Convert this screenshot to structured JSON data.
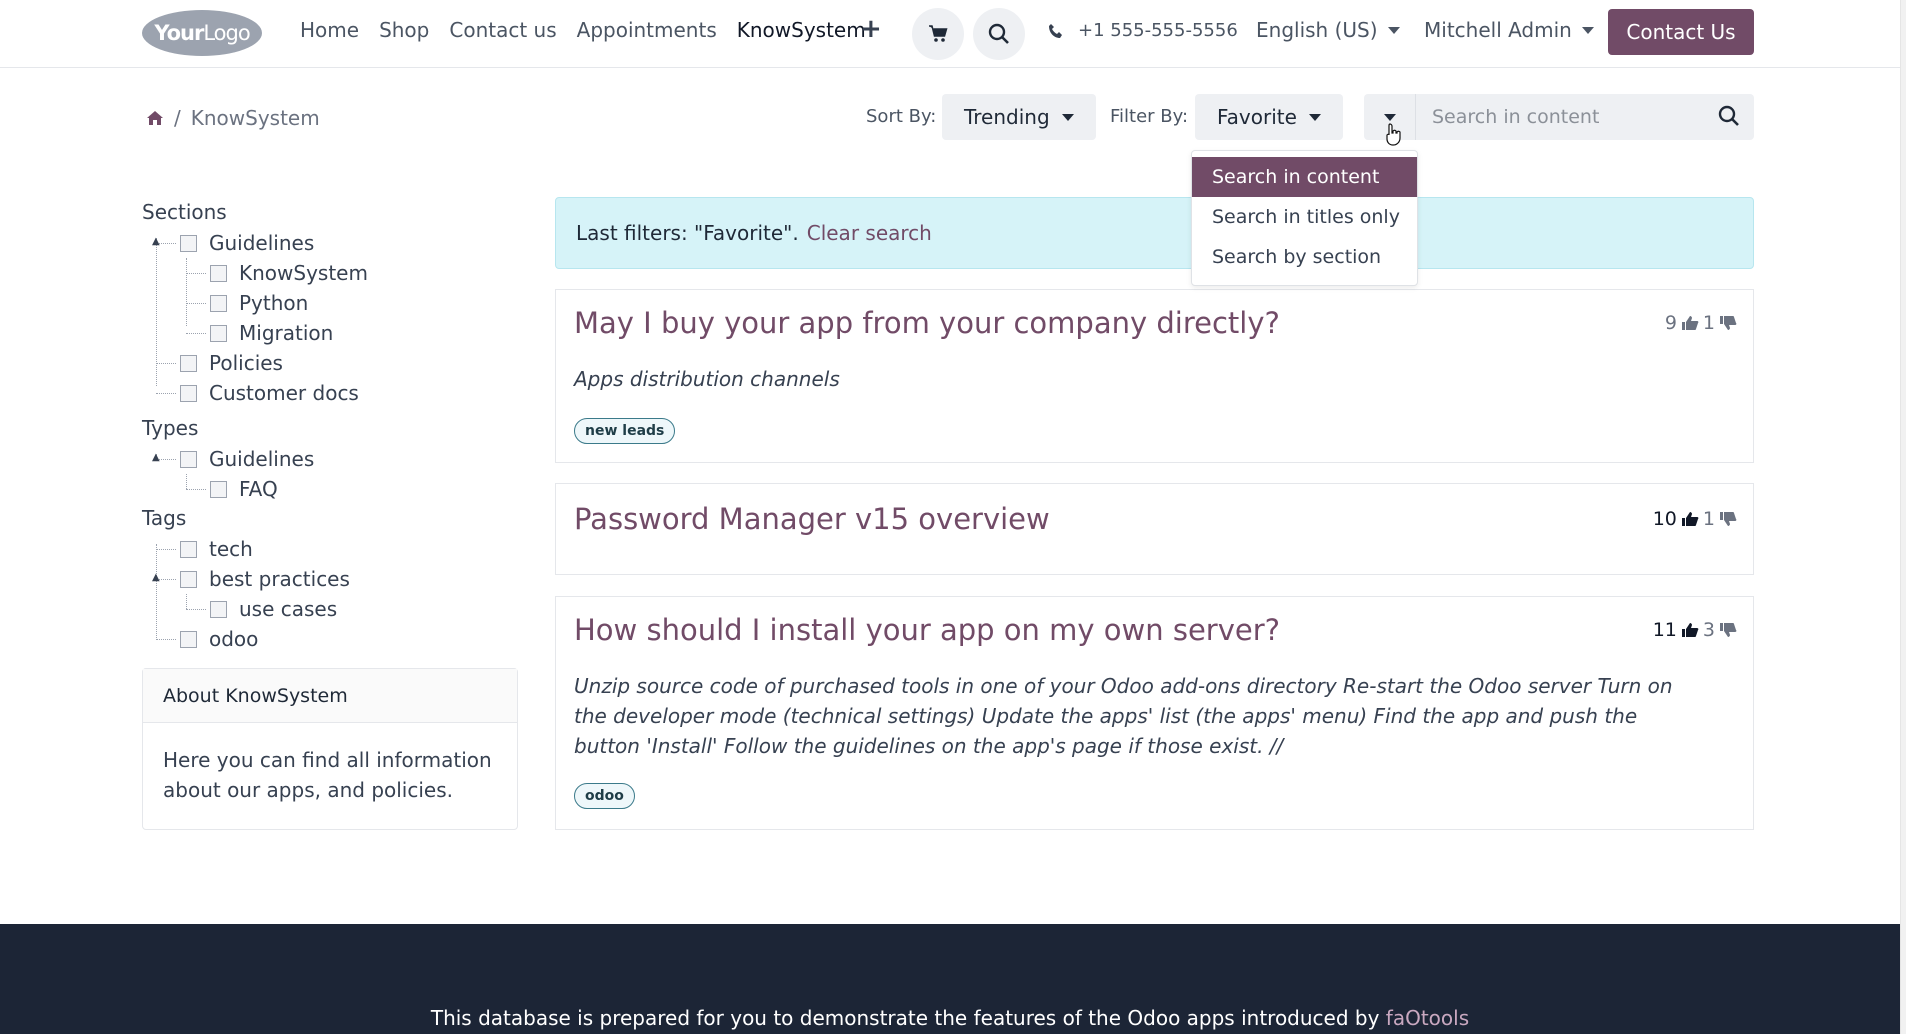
{
  "header": {
    "logo_main": "Your",
    "logo_sub": "Logo",
    "nav": [
      "Home",
      "Shop",
      "Contact us",
      "Appointments",
      "KnowSystem"
    ],
    "phone": "+1 555-555-5556",
    "language": "English (US)",
    "user": "Mitchell Admin",
    "contact_button": "Contact Us"
  },
  "breadcrumb": {
    "current": "KnowSystem"
  },
  "toolbar": {
    "sort_label": "Sort By:",
    "sort_value": "Trending",
    "filter_label": "Filter By:",
    "filter_value": "Favorite",
    "search_placeholder": "Search in content"
  },
  "search_dropdown": {
    "items": [
      "Search in content",
      "Search in titles only",
      "Search by section"
    ],
    "active_index": 0
  },
  "sidebar": {
    "sections_title": "Sections",
    "sections": [
      "Guidelines",
      "KnowSystem",
      "Python",
      "Migration",
      "Policies",
      "Customer docs"
    ],
    "types_title": "Types",
    "types": [
      "Guidelines",
      "FAQ"
    ],
    "tags_title": "Tags",
    "tags": [
      "tech",
      "best practices",
      "use cases",
      "odoo"
    ],
    "about_title": "About KnowSystem",
    "about_text": "Here you can find all information about our apps, and policies."
  },
  "alert": {
    "text": "Last filters: \"Favorite\".",
    "clear_link": "Clear search"
  },
  "articles": [
    {
      "title": "May I buy your app from your company directly?",
      "likes": "9",
      "dislikes": "1",
      "description": "Apps distribution channels",
      "tag": "new leads"
    },
    {
      "title": "Password Manager v15 overview",
      "likes": "10",
      "dislikes": "1"
    },
    {
      "title": "How should I install your app on my own server?",
      "likes": "11",
      "dislikes": "3",
      "description": "Unzip source code of purchased tools in one of your Odoo add-ons directory Re-start the Odoo server Turn on the developer mode (technical settings) Update the apps' list (the apps' menu) Find the app and push the button 'Install' Follow the guidelines on the app's page if those exist. //",
      "tag": "odoo"
    }
  ],
  "footer": {
    "text": "This database is prepared for you to demonstrate the features of the Odoo apps introduced by",
    "link": "faOtools"
  },
  "colors": {
    "brand": "#714B67",
    "alert_bg": "#d6f3f8",
    "footer_bg": "#1c2536"
  }
}
